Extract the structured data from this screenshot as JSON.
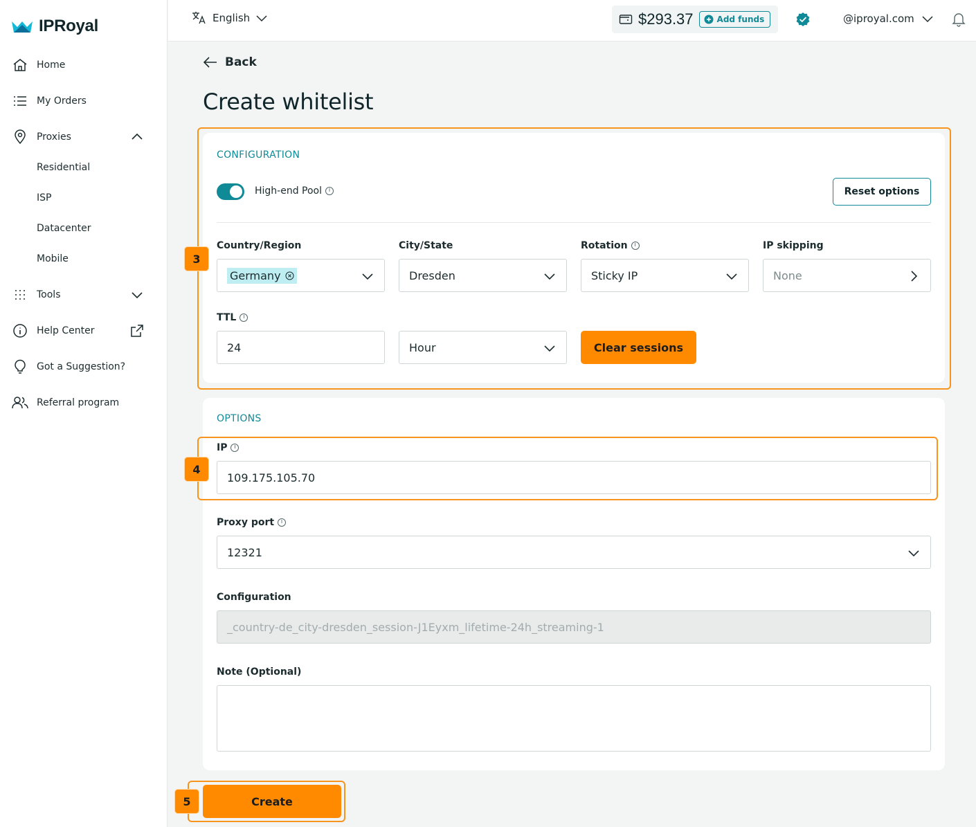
{
  "brand": {
    "name": "IPRoyal",
    "accent": "#0f8a96",
    "orange": "#ff8a00"
  },
  "sidebar": {
    "items": [
      {
        "label": "Home",
        "icon": "home-icon"
      },
      {
        "label": "My Orders",
        "icon": "list-icon"
      },
      {
        "label": "Proxies",
        "icon": "location-pin-icon"
      },
      {
        "label": "Tools",
        "icon": "grid-dots-icon"
      },
      {
        "label": "Help Center",
        "icon": "info-icon"
      },
      {
        "label": "Got a Suggestion?",
        "icon": "lightbulb-icon"
      },
      {
        "label": "Referral program",
        "icon": "users-icon"
      }
    ],
    "proxies_sub": [
      "Residential",
      "ISP",
      "Datacenter",
      "Mobile"
    ]
  },
  "topbar": {
    "language": "English",
    "balance": "$293.37",
    "add_funds": "Add funds",
    "account": "@iproyal.com"
  },
  "page": {
    "back": "Back",
    "title": "Create whitelist"
  },
  "configuration": {
    "section_title": "CONFIGURATION",
    "high_end_pool_label": "High-end Pool",
    "high_end_pool_on": true,
    "reset_button": "Reset options",
    "country_label": "Country/Region",
    "country_value": "Germany",
    "city_label": "City/State",
    "city_value": "Dresden",
    "rotation_label": "Rotation",
    "rotation_value": "Sticky IP",
    "ip_skipping_label": "IP skipping",
    "ip_skipping_value": "None",
    "ttl_label": "TTL",
    "ttl_value": "24",
    "ttl_unit": "Hour",
    "clear_sessions": "Clear sessions"
  },
  "options": {
    "section_title": "OPTIONS",
    "ip_label": "IP",
    "ip_value": "109.175.105.70",
    "proxy_port_label": "Proxy port",
    "proxy_port_value": "12321",
    "config_label": "Configuration",
    "config_value": "_country-de_city-dresden_session-J1Eyxm_lifetime-24h_streaming-1",
    "note_label": "Note (Optional)",
    "note_value": ""
  },
  "create_button": "Create",
  "steps": [
    "3",
    "4",
    "5"
  ]
}
